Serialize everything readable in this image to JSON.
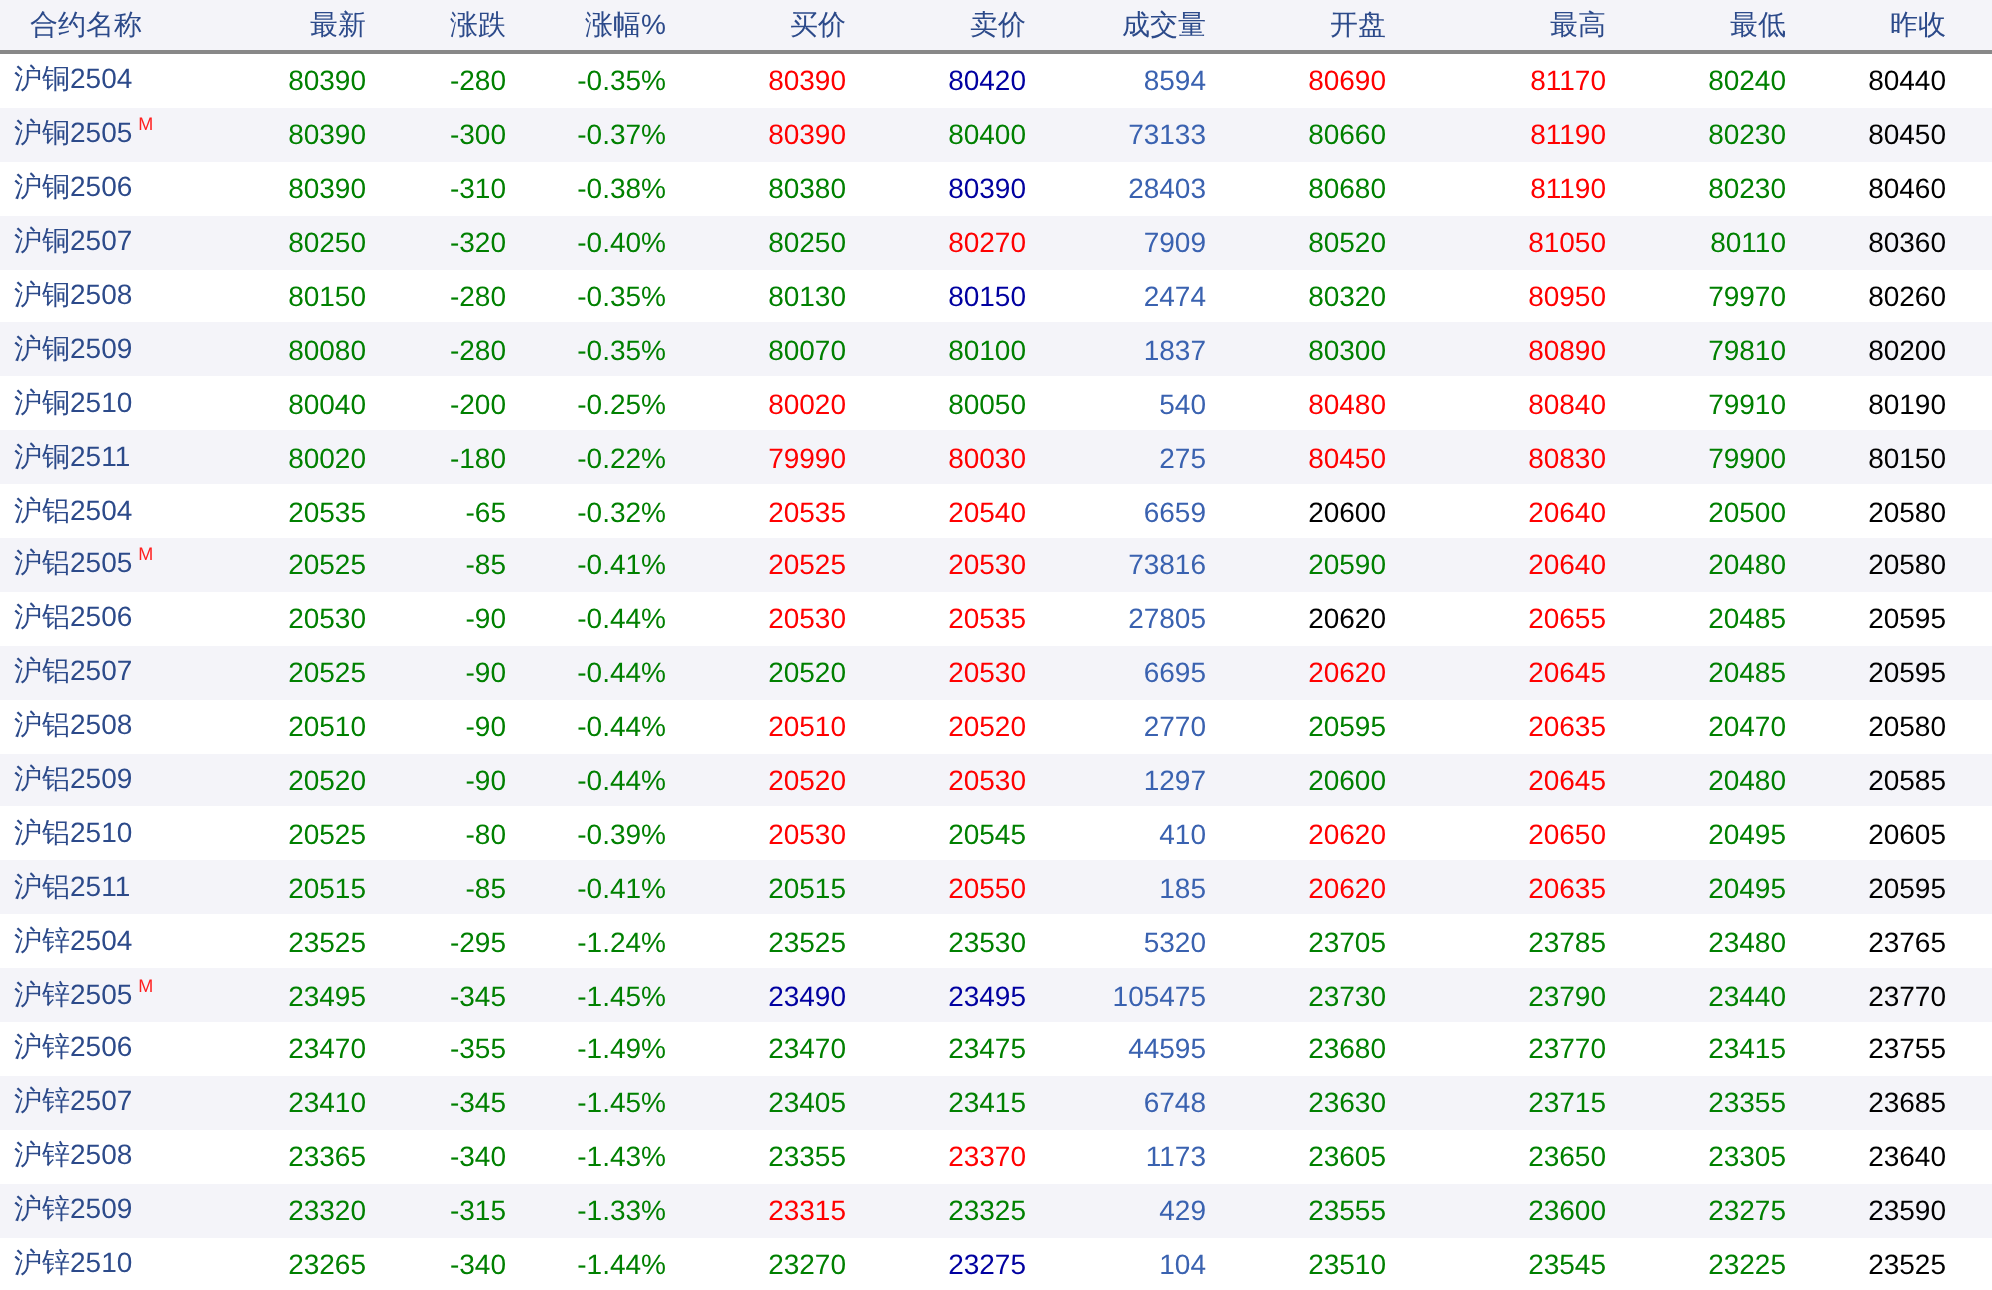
{
  "table": {
    "columns": [
      "合约名称",
      "最新",
      "涨跌",
      "涨幅%",
      "买价",
      "卖价",
      "成交量",
      "开盘",
      "最高",
      "最低",
      "昨收"
    ],
    "rows": [
      {
        "cells": [
          {
            "text": "沪铜2504"
          },
          {
            "text": "80390",
            "color": "#008000"
          },
          {
            "text": "-280",
            "color": "#008000"
          },
          {
            "text": "-0.35%",
            "color": "#008000"
          },
          {
            "text": "80390",
            "color": "#ff0000"
          },
          {
            "text": "80420",
            "color": "#0000a0"
          },
          {
            "text": "8594",
            "color": "#3a62b0"
          },
          {
            "text": "80690",
            "color": "#ff0000"
          },
          {
            "text": "81170",
            "color": "#ff0000"
          },
          {
            "text": "80240",
            "color": "#008000"
          },
          {
            "text": "80440",
            "color": "#000000"
          }
        ]
      },
      {
        "cells": [
          {
            "text": "沪铜2505",
            "badge": "M"
          },
          {
            "text": "80390",
            "color": "#008000"
          },
          {
            "text": "-300",
            "color": "#008000"
          },
          {
            "text": "-0.37%",
            "color": "#008000"
          },
          {
            "text": "80390",
            "color": "#ff0000"
          },
          {
            "text": "80400",
            "color": "#008000"
          },
          {
            "text": "73133",
            "color": "#3a62b0"
          },
          {
            "text": "80660",
            "color": "#008000"
          },
          {
            "text": "81190",
            "color": "#ff0000"
          },
          {
            "text": "80230",
            "color": "#008000"
          },
          {
            "text": "80450",
            "color": "#000000"
          }
        ]
      },
      {
        "cells": [
          {
            "text": "沪铜2506"
          },
          {
            "text": "80390",
            "color": "#008000"
          },
          {
            "text": "-310",
            "color": "#008000"
          },
          {
            "text": "-0.38%",
            "color": "#008000"
          },
          {
            "text": "80380",
            "color": "#008000"
          },
          {
            "text": "80390",
            "color": "#0000a0"
          },
          {
            "text": "28403",
            "color": "#3a62b0"
          },
          {
            "text": "80680",
            "color": "#008000"
          },
          {
            "text": "81190",
            "color": "#ff0000"
          },
          {
            "text": "80230",
            "color": "#008000"
          },
          {
            "text": "80460",
            "color": "#000000"
          }
        ]
      },
      {
        "cells": [
          {
            "text": "沪铜2507"
          },
          {
            "text": "80250",
            "color": "#008000"
          },
          {
            "text": "-320",
            "color": "#008000"
          },
          {
            "text": "-0.40%",
            "color": "#008000"
          },
          {
            "text": "80250",
            "color": "#008000"
          },
          {
            "text": "80270",
            "color": "#ff0000"
          },
          {
            "text": "7909",
            "color": "#3a62b0"
          },
          {
            "text": "80520",
            "color": "#008000"
          },
          {
            "text": "81050",
            "color": "#ff0000"
          },
          {
            "text": "80110",
            "color": "#008000"
          },
          {
            "text": "80360",
            "color": "#000000"
          }
        ]
      },
      {
        "cells": [
          {
            "text": "沪铜2508"
          },
          {
            "text": "80150",
            "color": "#008000"
          },
          {
            "text": "-280",
            "color": "#008000"
          },
          {
            "text": "-0.35%",
            "color": "#008000"
          },
          {
            "text": "80130",
            "color": "#008000"
          },
          {
            "text": "80150",
            "color": "#0000a0"
          },
          {
            "text": "2474",
            "color": "#3a62b0"
          },
          {
            "text": "80320",
            "color": "#008000"
          },
          {
            "text": "80950",
            "color": "#ff0000"
          },
          {
            "text": "79970",
            "color": "#008000"
          },
          {
            "text": "80260",
            "color": "#000000"
          }
        ]
      },
      {
        "cells": [
          {
            "text": "沪铜2509"
          },
          {
            "text": "80080",
            "color": "#008000"
          },
          {
            "text": "-280",
            "color": "#008000"
          },
          {
            "text": "-0.35%",
            "color": "#008000"
          },
          {
            "text": "80070",
            "color": "#008000"
          },
          {
            "text": "80100",
            "color": "#008000"
          },
          {
            "text": "1837",
            "color": "#3a62b0"
          },
          {
            "text": "80300",
            "color": "#008000"
          },
          {
            "text": "80890",
            "color": "#ff0000"
          },
          {
            "text": "79810",
            "color": "#008000"
          },
          {
            "text": "80200",
            "color": "#000000"
          }
        ]
      },
      {
        "cells": [
          {
            "text": "沪铜2510"
          },
          {
            "text": "80040",
            "color": "#008000"
          },
          {
            "text": "-200",
            "color": "#008000"
          },
          {
            "text": "-0.25%",
            "color": "#008000"
          },
          {
            "text": "80020",
            "color": "#ff0000"
          },
          {
            "text": "80050",
            "color": "#008000"
          },
          {
            "text": "540",
            "color": "#3a62b0"
          },
          {
            "text": "80480",
            "color": "#ff0000"
          },
          {
            "text": "80840",
            "color": "#ff0000"
          },
          {
            "text": "79910",
            "color": "#008000"
          },
          {
            "text": "80190",
            "color": "#000000"
          }
        ]
      },
      {
        "cells": [
          {
            "text": "沪铜2511"
          },
          {
            "text": "80020",
            "color": "#008000"
          },
          {
            "text": "-180",
            "color": "#008000"
          },
          {
            "text": "-0.22%",
            "color": "#008000"
          },
          {
            "text": "79990",
            "color": "#ff0000"
          },
          {
            "text": "80030",
            "color": "#ff0000"
          },
          {
            "text": "275",
            "color": "#3a62b0"
          },
          {
            "text": "80450",
            "color": "#ff0000"
          },
          {
            "text": "80830",
            "color": "#ff0000"
          },
          {
            "text": "79900",
            "color": "#008000"
          },
          {
            "text": "80150",
            "color": "#000000"
          }
        ]
      },
      {
        "cells": [
          {
            "text": "沪铝2504"
          },
          {
            "text": "20535",
            "color": "#008000"
          },
          {
            "text": "-65",
            "color": "#008000"
          },
          {
            "text": "-0.32%",
            "color": "#008000"
          },
          {
            "text": "20535",
            "color": "#ff0000"
          },
          {
            "text": "20540",
            "color": "#ff0000"
          },
          {
            "text": "6659",
            "color": "#3a62b0"
          },
          {
            "text": "20600",
            "color": "#000000"
          },
          {
            "text": "20640",
            "color": "#ff0000"
          },
          {
            "text": "20500",
            "color": "#008000"
          },
          {
            "text": "20580",
            "color": "#000000"
          }
        ]
      },
      {
        "cells": [
          {
            "text": "沪铝2505",
            "badge": "M"
          },
          {
            "text": "20525",
            "color": "#008000"
          },
          {
            "text": "-85",
            "color": "#008000"
          },
          {
            "text": "-0.41%",
            "color": "#008000"
          },
          {
            "text": "20525",
            "color": "#ff0000"
          },
          {
            "text": "20530",
            "color": "#ff0000"
          },
          {
            "text": "73816",
            "color": "#3a62b0"
          },
          {
            "text": "20590",
            "color": "#008000"
          },
          {
            "text": "20640",
            "color": "#ff0000"
          },
          {
            "text": "20480",
            "color": "#008000"
          },
          {
            "text": "20580",
            "color": "#000000"
          }
        ]
      },
      {
        "cells": [
          {
            "text": "沪铝2506"
          },
          {
            "text": "20530",
            "color": "#008000"
          },
          {
            "text": "-90",
            "color": "#008000"
          },
          {
            "text": "-0.44%",
            "color": "#008000"
          },
          {
            "text": "20530",
            "color": "#ff0000"
          },
          {
            "text": "20535",
            "color": "#ff0000"
          },
          {
            "text": "27805",
            "color": "#3a62b0"
          },
          {
            "text": "20620",
            "color": "#000000"
          },
          {
            "text": "20655",
            "color": "#ff0000"
          },
          {
            "text": "20485",
            "color": "#008000"
          },
          {
            "text": "20595",
            "color": "#000000"
          }
        ]
      },
      {
        "cells": [
          {
            "text": "沪铝2507"
          },
          {
            "text": "20525",
            "color": "#008000"
          },
          {
            "text": "-90",
            "color": "#008000"
          },
          {
            "text": "-0.44%",
            "color": "#008000"
          },
          {
            "text": "20520",
            "color": "#008000"
          },
          {
            "text": "20530",
            "color": "#ff0000"
          },
          {
            "text": "6695",
            "color": "#3a62b0"
          },
          {
            "text": "20620",
            "color": "#ff0000"
          },
          {
            "text": "20645",
            "color": "#ff0000"
          },
          {
            "text": "20485",
            "color": "#008000"
          },
          {
            "text": "20595",
            "color": "#000000"
          }
        ]
      },
      {
        "cells": [
          {
            "text": "沪铝2508"
          },
          {
            "text": "20510",
            "color": "#008000"
          },
          {
            "text": "-90",
            "color": "#008000"
          },
          {
            "text": "-0.44%",
            "color": "#008000"
          },
          {
            "text": "20510",
            "color": "#ff0000"
          },
          {
            "text": "20520",
            "color": "#ff0000"
          },
          {
            "text": "2770",
            "color": "#3a62b0"
          },
          {
            "text": "20595",
            "color": "#008000"
          },
          {
            "text": "20635",
            "color": "#ff0000"
          },
          {
            "text": "20470",
            "color": "#008000"
          },
          {
            "text": "20580",
            "color": "#000000"
          }
        ]
      },
      {
        "cells": [
          {
            "text": "沪铝2509"
          },
          {
            "text": "20520",
            "color": "#008000"
          },
          {
            "text": "-90",
            "color": "#008000"
          },
          {
            "text": "-0.44%",
            "color": "#008000"
          },
          {
            "text": "20520",
            "color": "#ff0000"
          },
          {
            "text": "20530",
            "color": "#ff0000"
          },
          {
            "text": "1297",
            "color": "#3a62b0"
          },
          {
            "text": "20600",
            "color": "#008000"
          },
          {
            "text": "20645",
            "color": "#ff0000"
          },
          {
            "text": "20480",
            "color": "#008000"
          },
          {
            "text": "20585",
            "color": "#000000"
          }
        ]
      },
      {
        "cells": [
          {
            "text": "沪铝2510"
          },
          {
            "text": "20525",
            "color": "#008000"
          },
          {
            "text": "-80",
            "color": "#008000"
          },
          {
            "text": "-0.39%",
            "color": "#008000"
          },
          {
            "text": "20530",
            "color": "#ff0000"
          },
          {
            "text": "20545",
            "color": "#008000"
          },
          {
            "text": "410",
            "color": "#3a62b0"
          },
          {
            "text": "20620",
            "color": "#ff0000"
          },
          {
            "text": "20650",
            "color": "#ff0000"
          },
          {
            "text": "20495",
            "color": "#008000"
          },
          {
            "text": "20605",
            "color": "#000000"
          }
        ]
      },
      {
        "cells": [
          {
            "text": "沪铝2511"
          },
          {
            "text": "20515",
            "color": "#008000"
          },
          {
            "text": "-85",
            "color": "#008000"
          },
          {
            "text": "-0.41%",
            "color": "#008000"
          },
          {
            "text": "20515",
            "color": "#008000"
          },
          {
            "text": "20550",
            "color": "#ff0000"
          },
          {
            "text": "185",
            "color": "#3a62b0"
          },
          {
            "text": "20620",
            "color": "#ff0000"
          },
          {
            "text": "20635",
            "color": "#ff0000"
          },
          {
            "text": "20495",
            "color": "#008000"
          },
          {
            "text": "20595",
            "color": "#000000"
          }
        ]
      },
      {
        "cells": [
          {
            "text": "沪锌2504"
          },
          {
            "text": "23525",
            "color": "#008000"
          },
          {
            "text": "-295",
            "color": "#008000"
          },
          {
            "text": "-1.24%",
            "color": "#008000"
          },
          {
            "text": "23525",
            "color": "#008000"
          },
          {
            "text": "23530",
            "color": "#008000"
          },
          {
            "text": "5320",
            "color": "#3a62b0"
          },
          {
            "text": "23705",
            "color": "#008000"
          },
          {
            "text": "23785",
            "color": "#008000"
          },
          {
            "text": "23480",
            "color": "#008000"
          },
          {
            "text": "23765",
            "color": "#000000"
          }
        ]
      },
      {
        "cells": [
          {
            "text": "沪锌2505",
            "badge": "M"
          },
          {
            "text": "23495",
            "color": "#008000"
          },
          {
            "text": "-345",
            "color": "#008000"
          },
          {
            "text": "-1.45%",
            "color": "#008000"
          },
          {
            "text": "23490",
            "color": "#0000a0"
          },
          {
            "text": "23495",
            "color": "#0000a0"
          },
          {
            "text": "105475",
            "color": "#3a62b0"
          },
          {
            "text": "23730",
            "color": "#008000"
          },
          {
            "text": "23790",
            "color": "#008000"
          },
          {
            "text": "23440",
            "color": "#008000"
          },
          {
            "text": "23770",
            "color": "#000000"
          }
        ]
      },
      {
        "cells": [
          {
            "text": "沪锌2506"
          },
          {
            "text": "23470",
            "color": "#008000"
          },
          {
            "text": "-355",
            "color": "#008000"
          },
          {
            "text": "-1.49%",
            "color": "#008000"
          },
          {
            "text": "23470",
            "color": "#008000"
          },
          {
            "text": "23475",
            "color": "#008000"
          },
          {
            "text": "44595",
            "color": "#3a62b0"
          },
          {
            "text": "23680",
            "color": "#008000"
          },
          {
            "text": "23770",
            "color": "#008000"
          },
          {
            "text": "23415",
            "color": "#008000"
          },
          {
            "text": "23755",
            "color": "#000000"
          }
        ]
      },
      {
        "cells": [
          {
            "text": "沪锌2507"
          },
          {
            "text": "23410",
            "color": "#008000"
          },
          {
            "text": "-345",
            "color": "#008000"
          },
          {
            "text": "-1.45%",
            "color": "#008000"
          },
          {
            "text": "23405",
            "color": "#008000"
          },
          {
            "text": "23415",
            "color": "#008000"
          },
          {
            "text": "6748",
            "color": "#3a62b0"
          },
          {
            "text": "23630",
            "color": "#008000"
          },
          {
            "text": "23715",
            "color": "#008000"
          },
          {
            "text": "23355",
            "color": "#008000"
          },
          {
            "text": "23685",
            "color": "#000000"
          }
        ]
      },
      {
        "cells": [
          {
            "text": "沪锌2508"
          },
          {
            "text": "23365",
            "color": "#008000"
          },
          {
            "text": "-340",
            "color": "#008000"
          },
          {
            "text": "-1.43%",
            "color": "#008000"
          },
          {
            "text": "23355",
            "color": "#008000"
          },
          {
            "text": "23370",
            "color": "#ff0000"
          },
          {
            "text": "1173",
            "color": "#3a62b0"
          },
          {
            "text": "23605",
            "color": "#008000"
          },
          {
            "text": "23650",
            "color": "#008000"
          },
          {
            "text": "23305",
            "color": "#008000"
          },
          {
            "text": "23640",
            "color": "#000000"
          }
        ]
      },
      {
        "cells": [
          {
            "text": "沪锌2509"
          },
          {
            "text": "23320",
            "color": "#008000"
          },
          {
            "text": "-315",
            "color": "#008000"
          },
          {
            "text": "-1.33%",
            "color": "#008000"
          },
          {
            "text": "23315",
            "color": "#ff0000"
          },
          {
            "text": "23325",
            "color": "#008000"
          },
          {
            "text": "429",
            "color": "#3a62b0"
          },
          {
            "text": "23555",
            "color": "#008000"
          },
          {
            "text": "23600",
            "color": "#008000"
          },
          {
            "text": "23275",
            "color": "#008000"
          },
          {
            "text": "23590",
            "color": "#000000"
          }
        ]
      },
      {
        "cells": [
          {
            "text": "沪锌2510"
          },
          {
            "text": "23265",
            "color": "#008000"
          },
          {
            "text": "-340",
            "color": "#008000"
          },
          {
            "text": "-1.44%",
            "color": "#008000"
          },
          {
            "text": "23270",
            "color": "#008000"
          },
          {
            "text": "23275",
            "color": "#0000a0"
          },
          {
            "text": "104",
            "color": "#3a62b0"
          },
          {
            "text": "23510",
            "color": "#008000"
          },
          {
            "text": "23545",
            "color": "#008000"
          },
          {
            "text": "23225",
            "color": "#008000"
          },
          {
            "text": "23525",
            "color": "#000000"
          }
        ]
      }
    ]
  }
}
